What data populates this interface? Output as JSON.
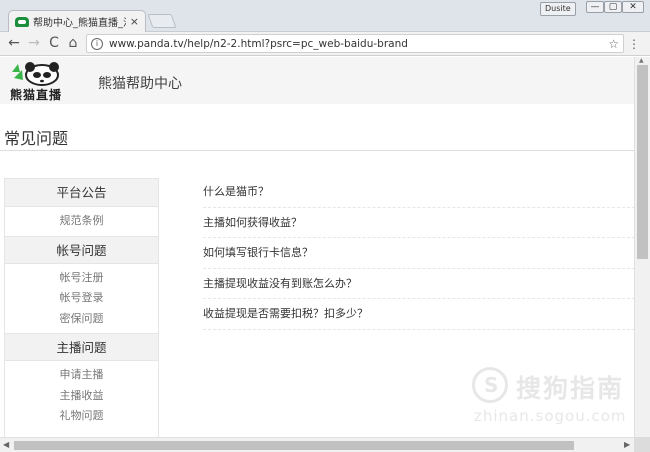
{
  "browser": {
    "tab_title": "帮助中心_熊猫直播_泛娱",
    "tab_close": "×",
    "user_button": "Dusite",
    "window_controls": {
      "minimize": "—",
      "maximize": "▢",
      "close": "✕"
    },
    "nav": {
      "back": "←",
      "forward": "→",
      "reload": "C",
      "home": "⌂"
    },
    "url": "www.panda.tv/help/n2-2.html?psrc=pc_web-baidu-brand",
    "info": "i",
    "star": "☆",
    "menu": "⋮"
  },
  "header": {
    "logo_text": "熊猫直播",
    "help_title": "熊猫帮助中心"
  },
  "faq_title": "常见问题",
  "sidebar": {
    "groups": [
      {
        "heading": "平台公告",
        "items": [
          "规范条例"
        ]
      },
      {
        "heading": "帐号问题",
        "items": [
          "帐号注册",
          "帐号登录",
          "密保问题"
        ]
      },
      {
        "heading": "主播问题",
        "items": [
          "申请主播",
          "主播收益",
          "礼物问题"
        ]
      }
    ]
  },
  "questions": [
    "什么是猫币？",
    "主播如何获得收益？",
    "如何填写银行卡信息？",
    "主播提现收益没有到账怎么办？",
    "收益提现是否需要扣税？扣多少？"
  ],
  "watermark": {
    "glyph": "S",
    "text": "搜狗指南",
    "url": "zhinan.sogou.com"
  },
  "colors": {
    "header_bg": "#f5f5f5",
    "sidebar_head_bg": "#f2f2f2",
    "tab_favicon": "#1a8e3a"
  }
}
